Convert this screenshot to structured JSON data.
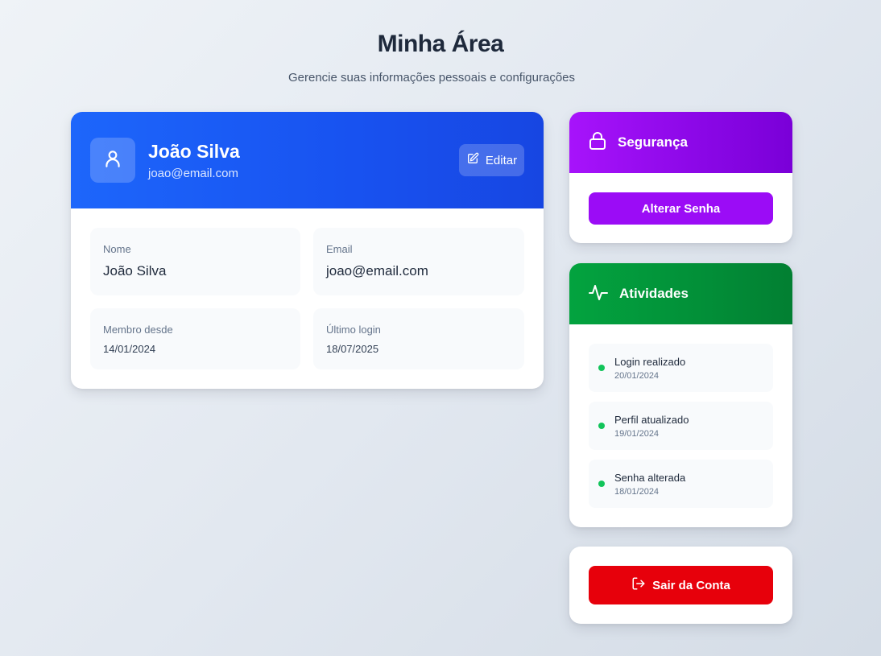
{
  "header": {
    "title": "Minha Área",
    "subtitle": "Gerencie suas informações pessoais e configurações"
  },
  "profile": {
    "name": "João Silva",
    "email": "joao@email.com",
    "avatar_icon": "user-icon",
    "edit_label": "Editar",
    "edit_icon": "edit-icon",
    "fields": {
      "name_label": "Nome",
      "name_value": "João Silva",
      "email_label": "Email",
      "email_value": "joao@email.com",
      "member_since_label": "Membro desde",
      "member_since_value": "14/01/2024",
      "last_login_label": "Último login",
      "last_login_value": "18/07/2025"
    }
  },
  "security": {
    "title": "Segurança",
    "icon": "lock-icon",
    "change_password_label": "Alterar Senha"
  },
  "activities": {
    "title": "Atividades",
    "icon": "activity-icon",
    "items": [
      {
        "title": "Login realizado",
        "date": "20/01/2024"
      },
      {
        "title": "Perfil atualizado",
        "date": "19/01/2024"
      },
      {
        "title": "Senha alterada",
        "date": "18/01/2024"
      }
    ]
  },
  "logout": {
    "label": "Sair da Conta",
    "icon": "logout-icon"
  },
  "colors": {
    "profile_header": "#1d66fb",
    "security_header": "#a713fb",
    "activities_header": "#03a33f",
    "activity_dot": "#12c45a",
    "logout_button": "#e7000b"
  }
}
